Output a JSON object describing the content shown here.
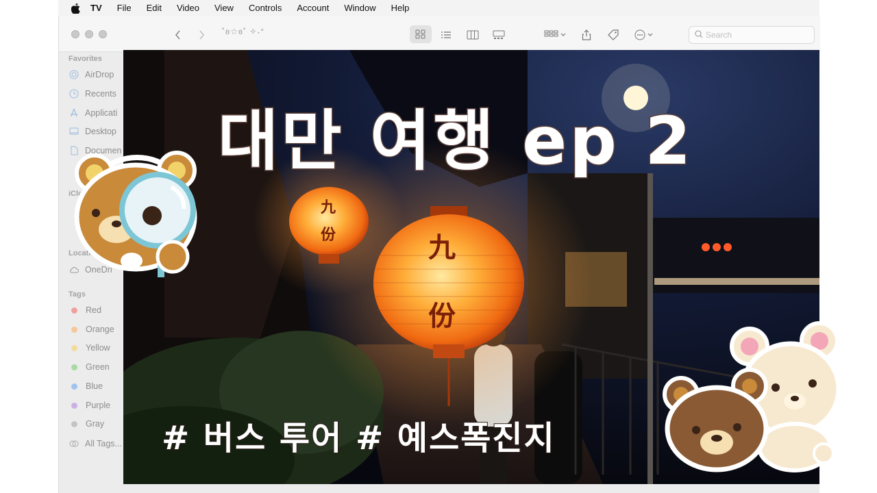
{
  "menubar": {
    "app": "TV",
    "items": [
      "File",
      "Edit",
      "Video",
      "View",
      "Controls",
      "Account",
      "Window",
      "Help"
    ]
  },
  "toolbar": {
    "window_title": "˚ʚ☆ɞ˚ ✧˖°",
    "search_placeholder": "Search"
  },
  "sidebar": {
    "favorites_header": "Favorites",
    "favorites": [
      "AirDrop",
      "Recents",
      "Applicati",
      "Desktop",
      "Documen"
    ],
    "icloud_header": "iClo",
    "locations_header": "Locations",
    "locations": [
      "OneDri"
    ],
    "tags_header": "Tags",
    "tags": [
      {
        "label": "Red",
        "color": "#f1a19b"
      },
      {
        "label": "Orange",
        "color": "#f6c79a"
      },
      {
        "label": "Yellow",
        "color": "#f3dc9a"
      },
      {
        "label": "Green",
        "color": "#a9d9a4"
      },
      {
        "label": "Blue",
        "color": "#9ec4ee"
      },
      {
        "label": "Purple",
        "color": "#cbb0e6"
      },
      {
        "label": "Gray",
        "color": "#c4c4c4"
      }
    ],
    "all_tags": "All Tags..."
  },
  "thumbnail": {
    "title": "대만 여행 ep 2",
    "tags": "# 버스 투어 # 예스폭진지",
    "lantern_text_top": "九",
    "lantern_text_bottom": "份"
  }
}
